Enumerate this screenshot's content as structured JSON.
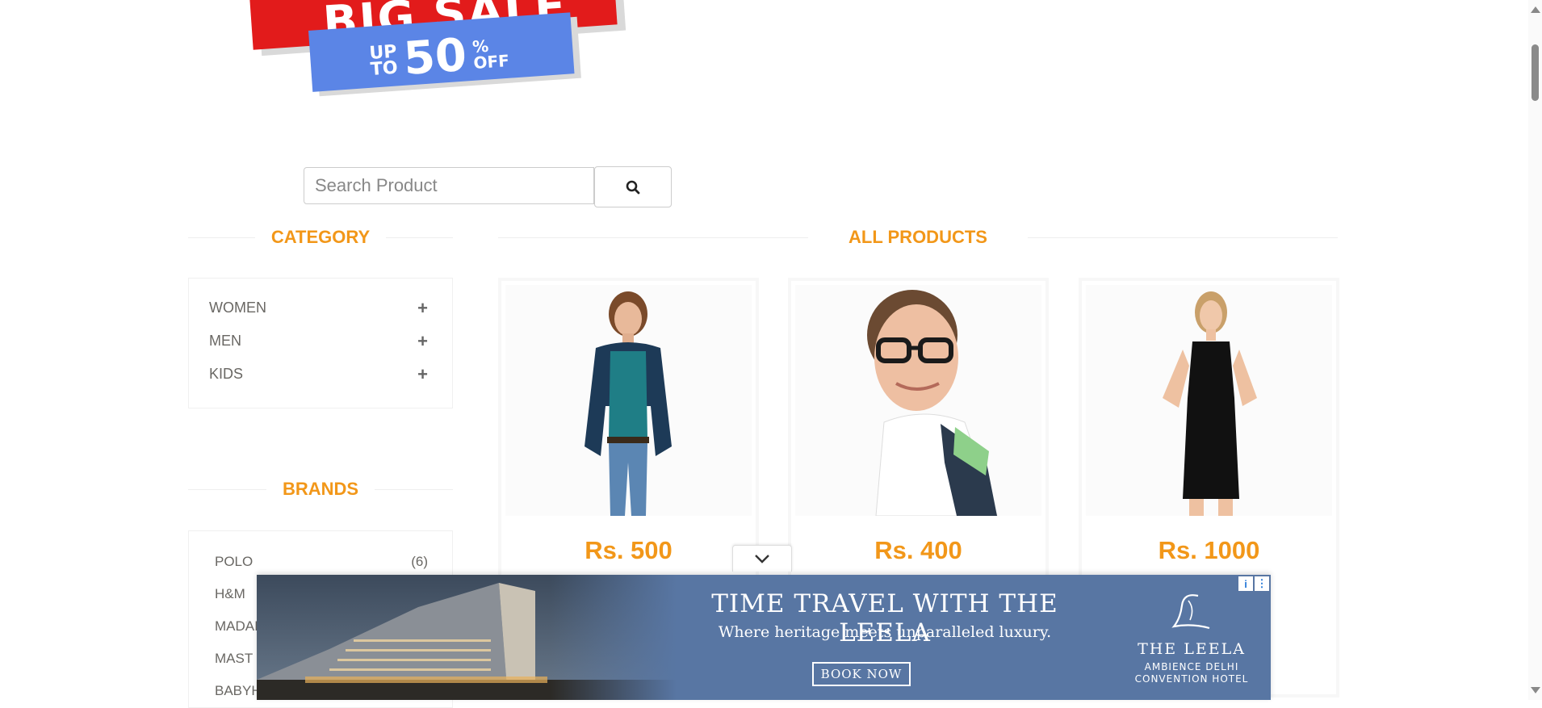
{
  "banner": {
    "headline": "BIG SALE",
    "up": "UP",
    "to": "TO",
    "percent": "50",
    "percent_sign": "%",
    "off": "OFF"
  },
  "search": {
    "placeholder": "Search Product",
    "value": ""
  },
  "category_section": {
    "title": "CATEGORY",
    "items": [
      {
        "label": "WOMEN",
        "icon": "plus-icon"
      },
      {
        "label": "MEN",
        "icon": "plus-icon"
      },
      {
        "label": "KIDS",
        "icon": "plus-icon"
      }
    ]
  },
  "brands_section": {
    "title": "BRANDS",
    "items": [
      {
        "label": "POLO",
        "count": "(6)"
      },
      {
        "label": "H&M",
        "count": ""
      },
      {
        "label": "MADAI",
        "count": ""
      },
      {
        "label": "MAST",
        "count": ""
      },
      {
        "label": "BABYH",
        "count": ""
      }
    ]
  },
  "products_section": {
    "title": "ALL PRODUCTS",
    "items": [
      {
        "price": "Rs. 500",
        "image": "woman-cardigan-jeans"
      },
      {
        "price": "Rs. 400",
        "image": "man-glasses-striped-shirt"
      },
      {
        "price": "Rs. 1000",
        "image": "woman-black-dress"
      }
    ]
  },
  "ad": {
    "headline": "TIME TRAVEL WITH THE LEELA",
    "subline": "Where heritage meets unparalleled luxury.",
    "cta": "BOOK NOW",
    "brand": "THE LEELA",
    "venue_line1": "AMBIENCE DELHI",
    "venue_line2": "CONVENTION HOTEL",
    "info_icon": "i",
    "menu_icon": "⋮"
  },
  "colors": {
    "accent": "#f29719",
    "sale_red": "#e21b1b",
    "sale_blue": "#5b85e6",
    "ad_bg": "#5876a3"
  }
}
